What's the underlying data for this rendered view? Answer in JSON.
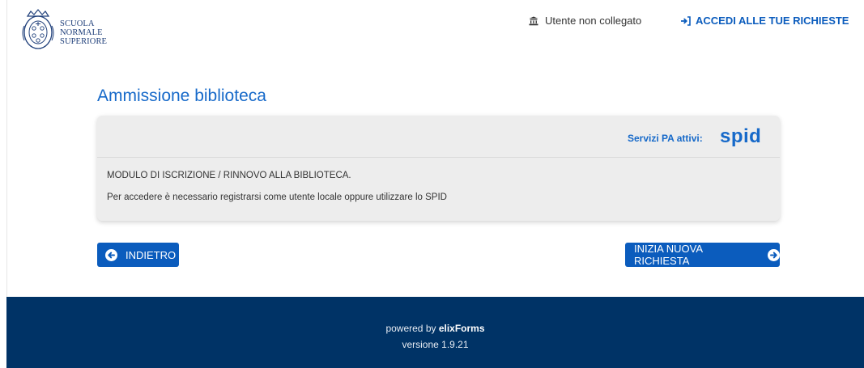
{
  "header": {
    "logo_text": [
      "SCUOLA",
      "NORMALE",
      "SUPERIORE"
    ],
    "user_status": "Utente non collegato",
    "login_link": "ACCEDI ALLE TUE RICHIESTE"
  },
  "main": {
    "title": "Ammissione biblioteca",
    "card": {
      "servizi_label": "Servizi PA attivi:",
      "spid_logo": "spid",
      "line1": "MODULO DI ISCRIZIONE / RINNOVO ALLA BIBLIOTECA.",
      "line2": "Per accedere è necessario registrarsi come utente locale oppure utilizzare lo SPID"
    },
    "buttons": {
      "back": "INDIETRO",
      "new_request": "INIZIA NUOVA RICHIESTA"
    }
  },
  "footer": {
    "powered_prefix": "powered by ",
    "powered_brand": "elixForms",
    "version": "versione 1.9.21"
  },
  "icons": {
    "user_status": "building-icon",
    "login": "sign-in-icon",
    "back": "arrow-left-circle-icon",
    "new": "arrow-right-circle-icon"
  },
  "colors": {
    "primary": "#0b5cbd",
    "title": "#1669c9",
    "footer_bg": "#003366",
    "card_bg": "#ededed"
  }
}
